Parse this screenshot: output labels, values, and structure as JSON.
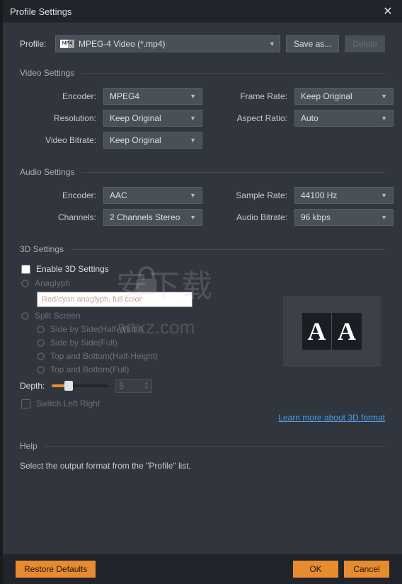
{
  "window": {
    "title": "Profile Settings"
  },
  "profile": {
    "label": "Profile:",
    "value": "MPEG-4 Video (*.mp4)",
    "save_as": "Save as...",
    "delete": "Delete"
  },
  "video": {
    "heading": "Video Settings",
    "encoder_label": "Encoder:",
    "encoder": "MPEG4",
    "framerate_label": "Frame Rate:",
    "framerate": "Keep Original",
    "resolution_label": "Resolution:",
    "resolution": "Keep Original",
    "aspect_label": "Aspect Ratio:",
    "aspect": "Auto",
    "bitrate_label": "Video Bitrate:",
    "bitrate": "Keep Original"
  },
  "audio": {
    "heading": "Audio Settings",
    "encoder_label": "Encoder:",
    "encoder": "AAC",
    "samplerate_label": "Sample Rate:",
    "samplerate": "44100 Hz",
    "channels_label": "Channels:",
    "channels": "2 Channels Stereo",
    "bitrate_label": "Audio Bitrate:",
    "bitrate": "96 kbps"
  },
  "three_d": {
    "heading": "3D Settings",
    "enable_label": "Enable 3D Settings",
    "anaglyph_label": "Anaglyph",
    "anaglyph_input": "Red/cyan anaglyph, full color",
    "split_label": "Split Screen",
    "sbs_half": "Side by Side(Half-Width)",
    "sbs_full": "Side by Side(Full)",
    "tab_half": "Top and Bottom(Half-Height)",
    "tab_full": "Top and Bottom(Full)",
    "depth_label": "Depth:",
    "depth_value": "5",
    "switch_label": "Switch Left Right",
    "learn_more": "Learn more about 3D format"
  },
  "help": {
    "heading": "Help",
    "text": "Select the output format from the \"Profile\" list."
  },
  "footer": {
    "restore": "Restore Defaults",
    "ok": "OK",
    "cancel": "Cancel"
  },
  "watermark": "安下载"
}
